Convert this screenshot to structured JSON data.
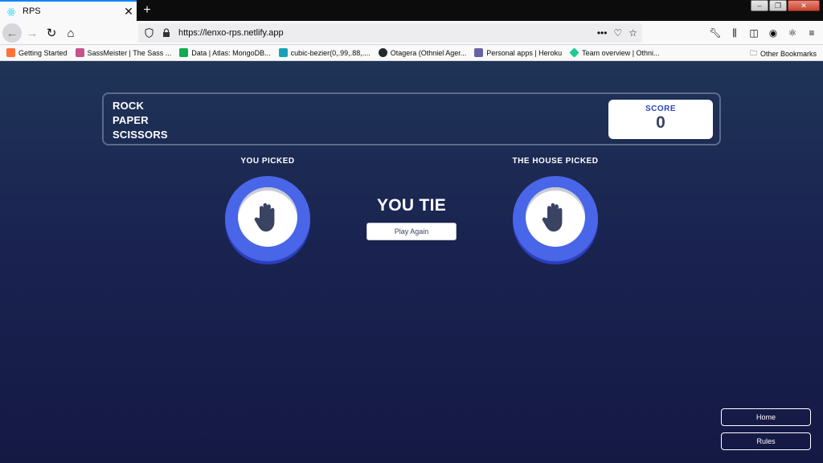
{
  "browser": {
    "tab": {
      "title": "RPS"
    },
    "address": {
      "url": "https://lenxo-rps.netlify.app"
    },
    "bookmarks": [
      {
        "label": "Getting Started",
        "color": "#ff7139"
      },
      {
        "label": "SassMeister | The Sass ...",
        "color": "#c6538c"
      },
      {
        "label": "Data | Atlas: MongoDB...",
        "color": "#13aa52"
      },
      {
        "label": "cubic-bezier(0,.99,.88,....",
        "color": "#17a2b8"
      },
      {
        "label": "Otagera (Othniel Ager...",
        "color": "#24292e"
      },
      {
        "label": "Personal apps | Heroku",
        "color": "#6762a6"
      },
      {
        "label": "Team overview | Othni...",
        "color": "#20c997"
      }
    ],
    "other_bookmarks": "Other Bookmarks"
  },
  "app": {
    "title_lines": [
      "ROCK",
      "PAPER",
      "SCISSORS"
    ],
    "score": {
      "label": "SCORE",
      "value": "0"
    },
    "you_picked_label": "YOU PICKED",
    "house_picked_label": "THE HOUSE PICKED",
    "your_choice": "paper",
    "house_choice": "paper",
    "result": "YOU TIE",
    "play_again": "Play Again",
    "nav": {
      "home": "Home",
      "rules": "Rules"
    },
    "colors": {
      "paper_ring": "#4966e8",
      "score_accent": "#2a46c0"
    }
  }
}
